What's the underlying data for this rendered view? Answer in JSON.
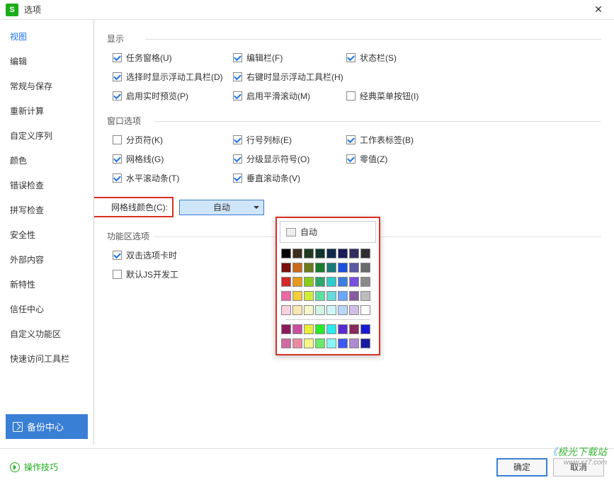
{
  "title": "选项",
  "sidebar": {
    "items": [
      "视图",
      "编辑",
      "常规与保存",
      "重新计算",
      "自定义序列",
      "颜色",
      "错误检查",
      "拼写检查",
      "安全性",
      "外部内容",
      "新特性",
      "信任中心",
      "自定义功能区",
      "快速访问工具栏"
    ],
    "activeIndex": 0,
    "backup": "备份中心"
  },
  "sections": {
    "display": {
      "title": "显示",
      "items": [
        {
          "label": "任务窗格(U)",
          "checked": true
        },
        {
          "label": "编辑栏(F)",
          "checked": true
        },
        {
          "label": "状态栏(S)",
          "checked": true
        },
        {
          "label": "选择时显示浮动工具栏(D)",
          "checked": true
        },
        {
          "label": "右键时显示浮动工具栏(H)",
          "checked": true
        },
        null,
        {
          "label": "启用实时预览(P)",
          "checked": true
        },
        {
          "label": "启用平滑滚动(M)",
          "checked": true
        },
        {
          "label": "经典菜单按钮(I)",
          "checked": false
        }
      ]
    },
    "window": {
      "title": "窗口选项",
      "items": [
        {
          "label": "分页符(K)",
          "checked": false
        },
        {
          "label": "行号列标(E)",
          "checked": true
        },
        {
          "label": "工作表标签(B)",
          "checked": true
        },
        {
          "label": "网格线(G)",
          "checked": true
        },
        {
          "label": "分级显示符号(O)",
          "checked": true
        },
        {
          "label": "零值(Z)",
          "checked": true
        },
        {
          "label": "水平滚动条(T)",
          "checked": true
        },
        {
          "label": "垂直滚动条(V)",
          "checked": true
        }
      ],
      "gridColorLabel": "网格线颜色(C):",
      "gridColorValue": "自动"
    },
    "ribbon": {
      "title": "功能区选项",
      "items": [
        {
          "label": "双击选项卡时",
          "checked": true
        },
        {
          "label": "默认JS开发工",
          "checked": false
        }
      ]
    }
  },
  "palette": {
    "autoLabel": "自动",
    "rows1": [
      [
        "#000000",
        "#3b2e1c",
        "#1f3a1f",
        "#10352f",
        "#102a4c",
        "#1a1a5c",
        "#2e2e60",
        "#2e2e2e"
      ],
      [
        "#7a0f0f",
        "#c96a1a",
        "#6b7a1a",
        "#1a7a2e",
        "#1a7a7a",
        "#1a4fe0",
        "#5a5aa0",
        "#6a6a6a"
      ],
      [
        "#d02a2a",
        "#e69c1a",
        "#8acc1a",
        "#2fa66a",
        "#2fcaca",
        "#3a7fe0",
        "#7a4fe0",
        "#8a8a8a"
      ],
      [
        "#e86aa6",
        "#f2cc3a",
        "#d2ec3a",
        "#5fe0a0",
        "#6adada",
        "#6aa6ff",
        "#8a5aa0",
        "#bdbdbd"
      ],
      [
        "#fbd0e0",
        "#fbe6b0",
        "#f2f6c8",
        "#d0f6e6",
        "#d0f6f6",
        "#b8d6fb",
        "#d0c0e8",
        "#ffffff"
      ]
    ],
    "rows2": [
      [
        "#8a1a5a",
        "#c94fa0",
        "#eaea3a",
        "#2aea2a",
        "#2aeaea",
        "#5a2ad0",
        "#8a2a5a",
        "#1a1ad0"
      ],
      [
        "#d06aa0",
        "#ea8aa0",
        "#f6f68a",
        "#6aea6a",
        "#8af6f6",
        "#3a5af6",
        "#b08ad0",
        "#1a1aa0"
      ]
    ]
  },
  "footer": {
    "tips": "操作技巧",
    "ok": "确定",
    "cancel": "取消"
  },
  "watermark": {
    "main": "极光下载站",
    "sub": "www.xz7.com"
  }
}
